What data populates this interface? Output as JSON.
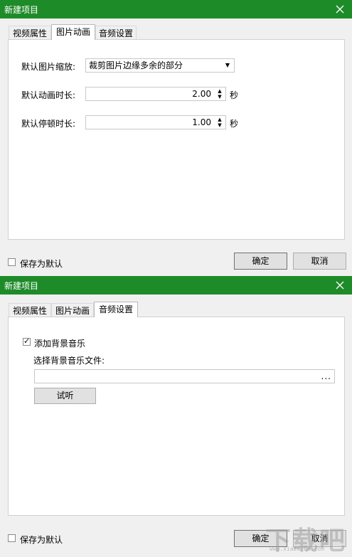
{
  "dialog1": {
    "title": "新建项目",
    "tabs": [
      "视频属性",
      "图片动画",
      "音频设置"
    ],
    "active_tab": "图片动画",
    "fields": {
      "scale_label": "默认图片缩放:",
      "scale_value": "裁剪图片边缘多余的部分",
      "anim_label": "默认动画时长:",
      "anim_value": "2.00",
      "anim_unit": "秒",
      "pause_label": "默认停顿时长:",
      "pause_value": "1.00",
      "pause_unit": "秒"
    },
    "save_default_label": "保存为默认",
    "ok_label": "确定",
    "cancel_label": "取消"
  },
  "dialog2": {
    "title": "新建项目",
    "tabs": [
      "视频属性",
      "图片动画",
      "音频设置"
    ],
    "active_tab": "音频设置",
    "add_music_label": "添加背景音乐",
    "add_music_checked": true,
    "select_file_label": "选择背景音乐文件:",
    "file_path_value": "",
    "browse_label": "...",
    "preview_label": "试听",
    "save_default_label": "保存为默认",
    "ok_label": "确定",
    "cancel_label": "取消"
  },
  "watermark": {
    "text": "下载吧",
    "url": "www.xiazaiba.com"
  }
}
